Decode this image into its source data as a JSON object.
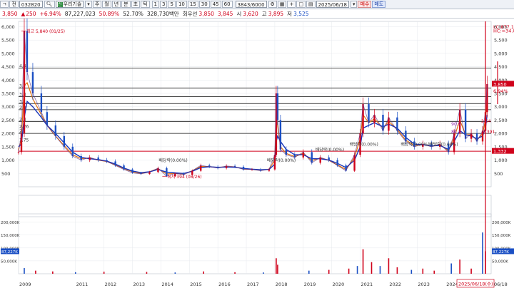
{
  "toolbar": {
    "prefix_label": "ㄱ",
    "list_label": "전",
    "stock_code": "032820",
    "search_icon": "magnifier-icon",
    "market_badge": "신",
    "stock_name": "우리기술",
    "period_buttons": [
      "주",
      "월",
      "년",
      "분",
      "초",
      "틱"
    ],
    "active_period": "",
    "minute_buttons": [
      "1",
      "3",
      "5",
      "10",
      "15",
      "30",
      "45",
      "60"
    ],
    "data_count": "3843/6000",
    "date_value": "2025/06/18",
    "buy_label": "매수",
    "sell_label": "매도"
  },
  "quote": {
    "price": "3,850",
    "change": "250",
    "change_pct": "+6.94%",
    "volume": "87,227,023",
    "ratio": "50.89%",
    "turnover": "52.70%",
    "value": "328,730백만",
    "label_current": "회우선",
    "current": "3,850",
    "prev": "3,845",
    "label_open": "시",
    "open": "3,620",
    "label_high": "고",
    "high": "3,895",
    "label_low": "저",
    "low": "3,525"
  },
  "colors": {
    "up": "#d0021b",
    "down": "#1a4fc4",
    "ma5": "#e0720f",
    "ma20": "#1a35b8",
    "highlight": "#d0021b",
    "grid": "#e6e9ee"
  },
  "chart_data": {
    "type": "line",
    "price_axis": {
      "ticks": [
        "6,000",
        "5,500",
        "5,000",
        "4,500",
        "4,000",
        "3,500",
        "3,000",
        "2,500",
        "2,000",
        "1,500",
        "1,000",
        "500"
      ],
      "tick_values": [
        6000,
        5500,
        5000,
        4500,
        4000,
        3500,
        3000,
        2500,
        2000,
        1500,
        1000,
        500
      ],
      "ylim": [
        0,
        6200
      ]
    },
    "price_series": {
      "x": [
        2009.0,
        2009.1,
        2009.2,
        2009.3,
        2009.5,
        2009.8,
        2010.0,
        2010.3,
        2010.6,
        2010.9,
        2011.2,
        2011.5,
        2011.8,
        2012.1,
        2012.4,
        2012.7,
        2013.0,
        2013.3,
        2013.6,
        2013.9,
        2014.2,
        2014.5,
        2014.8,
        2015.1,
        2015.4,
        2015.7,
        2016.0,
        2016.3,
        2016.6,
        2016.9,
        2017.2,
        2017.5,
        2017.8,
        2018.0,
        2018.05,
        2018.1,
        2018.2,
        2018.4,
        2018.7,
        2019.0,
        2019.3,
        2019.6,
        2019.9,
        2020.2,
        2020.5,
        2020.8,
        2021.0,
        2021.1,
        2021.3,
        2021.5,
        2021.8,
        2022.0,
        2022.3,
        2022.6,
        2022.9,
        2023.2,
        2023.5,
        2023.8,
        2024.1,
        2024.3,
        2024.5,
        2024.7,
        2024.9,
        2025.1,
        2025.3,
        2025.4,
        2025.46
      ],
      "values": [
        1300,
        2000,
        5840,
        4300,
        3500,
        2800,
        2300,
        1900,
        1500,
        1150,
        1000,
        1100,
        1000,
        950,
        800,
        650,
        520,
        480,
        550,
        700,
        394,
        500,
        450,
        600,
        800,
        750,
        700,
        780,
        750,
        650,
        650,
        600,
        650,
        1200,
        3500,
        2500,
        1400,
        1200,
        1100,
        1300,
        900,
        1100,
        1000,
        800,
        600,
        1200,
        2000,
        3100,
        2400,
        2700,
        2100,
        2600,
        2100,
        1700,
        1500,
        1600,
        1500,
        1600,
        1300,
        2000,
        2900,
        1800,
        2000,
        1700,
        2100,
        2800,
        3850
      ]
    },
    "ma_series": [
      {
        "values": [
          1400,
          1800,
          3800,
          3900,
          3300,
          2700,
          2300,
          1900,
          1550,
          1200,
          1050,
          1080,
          1000,
          950,
          820,
          680,
          560,
          500,
          560,
          680,
          480,
          500,
          480,
          600,
          760,
          760,
          720,
          760,
          740,
          670,
          650,
          620,
          660,
          1000,
          2600,
          2300,
          1500,
          1250,
          1130,
          1250,
          980,
          1080,
          990,
          820,
          650,
          1100,
          1800,
          2700,
          2400,
          2550,
          2200,
          2450,
          2150,
          1750,
          1550,
          1580,
          1520,
          1580,
          1350,
          1850,
          2500,
          1950,
          1950,
          1750,
          2000,
          2500,
          3300
        ]
      },
      {
        "values": [
          1500,
          1600,
          2600,
          3200,
          3000,
          2600,
          2300,
          2000,
          1650,
          1300,
          1100,
          1050,
          1020,
          960,
          850,
          700,
          590,
          530,
          560,
          650,
          550,
          520,
          500,
          580,
          720,
          750,
          730,
          740,
          730,
          690,
          660,
          640,
          650,
          850,
          1700,
          1900,
          1700,
          1400,
          1200,
          1200,
          1050,
          1050,
          1000,
          880,
          720,
          1000,
          1500,
          2200,
          2300,
          2400,
          2250,
          2350,
          2200,
          1850,
          1600,
          1580,
          1530,
          1550,
          1400,
          1700,
          2100,
          1950,
          1900,
          1800,
          1900,
          2200,
          2700
        ]
      }
    ],
    "annotations": [
      {
        "text": "최고 5,840 (01/25)",
        "x": 2009.25,
        "y": 5840
      },
      {
        "text": "최저 394 (08/26)",
        "x": 2014.2,
        "y": 394
      },
      {
        "text": "배당락(0.00%)",
        "x": 2013.9,
        "y": 1000
      },
      {
        "text": "배당락(0.00%)",
        "x": 2017.7,
        "y": 1000
      },
      {
        "text": "배당락(0.00%)",
        "x": 2019.4,
        "y": 1400
      },
      {
        "text": "배당락(0.00%)",
        "x": 2020.6,
        "y": 1600
      },
      {
        "text": "배당락(0.00%)",
        "x": 2022.4,
        "y": 1600
      },
      {
        "text": "배당락(0.00%)",
        "x": 2023.4,
        "y": 1600
      }
    ],
    "level_labels": [
      "4,4",
      "3,7",
      "3,4",
      "3,1",
      "2,9",
      "2,4",
      "2,"
    ],
    "level_left_labels": [
      "2,26",
      "1,75"
    ],
    "horizontal_levels": [
      4450,
      3700,
      3380,
      3120,
      2890,
      2450,
      2000,
      1332
    ],
    "right_labels": [
      {
        "text": "LC:877.16",
        "y": 6000
      },
      {
        "text": "HC:=34.08",
        "y": 5850
      },
      {
        "text": "3,850",
        "y": 3850,
        "box": true
      },
      {
        "text": "6.94%",
        "y": 3600
      },
      {
        "text": "1,332",
        "y": 1332,
        "box": true
      }
    ],
    "right_annotations": [
      {
        "text": "90.9",
        "x": 2024.2,
        "y": 2300
      },
      {
        "text": "84.3",
        "x": 2024.2,
        "y": 2000
      },
      {
        "text": "2,54",
        "x": 2025.25,
        "y": 2400
      },
      {
        "text": "2,391",
        "x": 2025.3,
        "y": 2000
      }
    ],
    "x_axis": {
      "labels": [
        "2009",
        "2011",
        "2012",
        "2013",
        "2014",
        "2015",
        "2016",
        "2017",
        "2018",
        "2019",
        "2020",
        "2021",
        "2022",
        "2023",
        "2024"
      ],
      "label_years": [
        2009,
        2011,
        2012,
        2013,
        2014,
        2015,
        2016,
        2017,
        2018,
        2019,
        2020,
        2021,
        2022,
        2023,
        2024
      ],
      "xlim": [
        2009.0,
        2025.6
      ],
      "cursor_date": "2025/06/18(수)",
      "end_label": "06/18"
    },
    "volume_axis": {
      "ticks": [
        "200,000K",
        "150,000K",
        "100,000K",
        "50,000K"
      ],
      "tick_values": [
        200000,
        150000,
        100000,
        50000
      ],
      "current_label": "87,227K",
      "ylim": [
        0,
        210000
      ]
    },
    "volume_bars": [
      {
        "x": 2009.2,
        "v": 22000
      },
      {
        "x": 2009.6,
        "v": 12000
      },
      {
        "x": 2010.2,
        "v": 9000
      },
      {
        "x": 2011.0,
        "v": 6000
      },
      {
        "x": 2012.0,
        "v": 8000
      },
      {
        "x": 2013.5,
        "v": 7000
      },
      {
        "x": 2014.5,
        "v": 5000
      },
      {
        "x": 2015.5,
        "v": 9000
      },
      {
        "x": 2016.6,
        "v": 6000
      },
      {
        "x": 2017.6,
        "v": 5000
      },
      {
        "x": 2018.05,
        "v": 60000
      },
      {
        "x": 2018.1,
        "v": 35000
      },
      {
        "x": 2019.2,
        "v": 12000
      },
      {
        "x": 2019.9,
        "v": 15000
      },
      {
        "x": 2020.6,
        "v": 20000
      },
      {
        "x": 2020.9,
        "v": 30000
      },
      {
        "x": 2021.1,
        "v": 95000
      },
      {
        "x": 2021.4,
        "v": 45000
      },
      {
        "x": 2021.7,
        "v": 30000
      },
      {
        "x": 2022.0,
        "v": 60000
      },
      {
        "x": 2022.3,
        "v": 25000
      },
      {
        "x": 2022.8,
        "v": 15000
      },
      {
        "x": 2023.2,
        "v": 20000
      },
      {
        "x": 2023.6,
        "v": 12000
      },
      {
        "x": 2024.2,
        "v": 40000
      },
      {
        "x": 2024.5,
        "v": 55000
      },
      {
        "x": 2024.9,
        "v": 20000
      },
      {
        "x": 2025.3,
        "v": 160000
      },
      {
        "x": 2025.4,
        "v": 87227
      }
    ]
  }
}
